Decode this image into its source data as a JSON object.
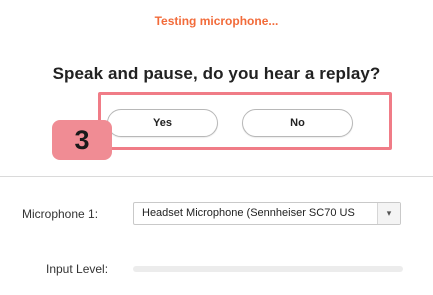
{
  "status_text": "Testing microphone...",
  "question": "Speak and pause, do you hear a replay?",
  "buttons": {
    "yes_label": "Yes",
    "no_label": "No"
  },
  "step_badge": "3",
  "microphone": {
    "label": "Microphone 1:",
    "selected_value": "Headset Microphone (Sennheiser SC70 US"
  },
  "input_level": {
    "label": "Input Level:",
    "level_fraction": 0
  },
  "colors": {
    "status": "#f26b3a",
    "highlight": "#f07c87",
    "badge": "#f08c94"
  },
  "icons": {
    "dropdown": "chevron-down-icon"
  }
}
